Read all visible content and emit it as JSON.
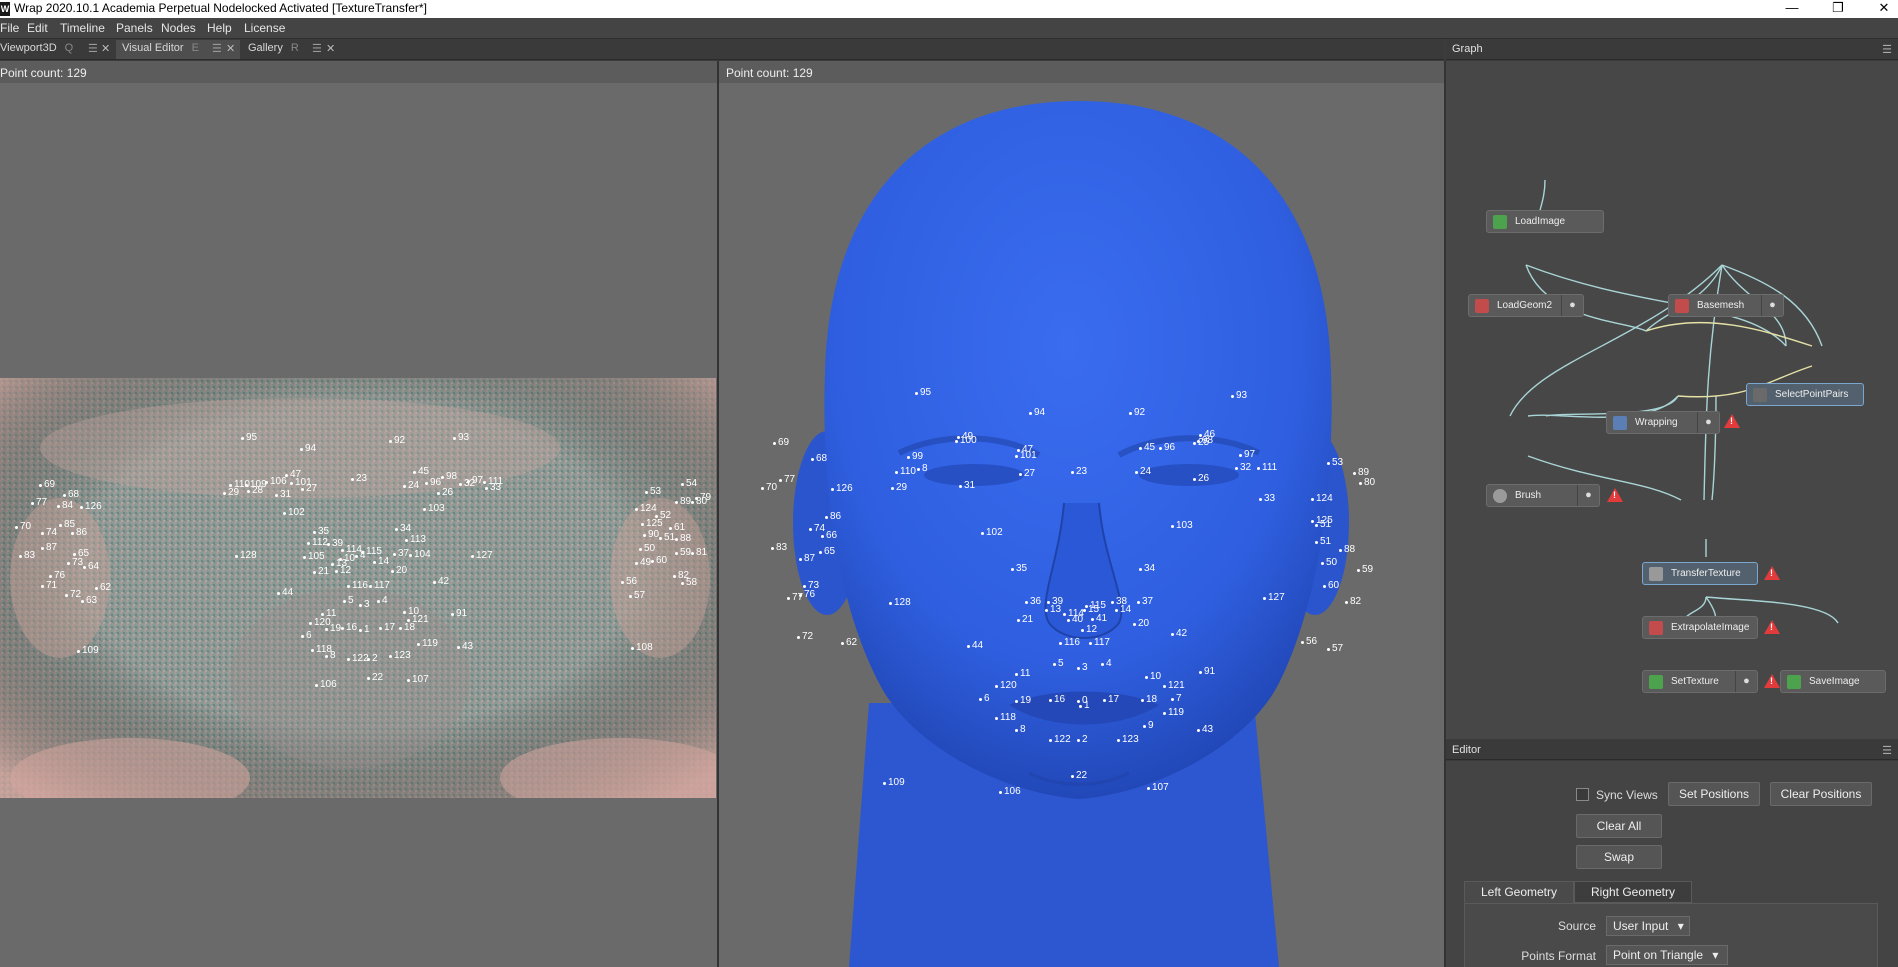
{
  "window": {
    "title": "Wrap 2020.10.1 Academia Perpetual Nodelocked Activated  [TextureTransfer*]",
    "icon_letter": "W",
    "minimize_glyph": "—",
    "restore_glyph": "❐",
    "close_glyph": "✕"
  },
  "menu": [
    "File",
    "Edit",
    "Timeline",
    "Panels",
    "Nodes",
    "Help",
    "License"
  ],
  "tabs": [
    {
      "label": "Viewport3D",
      "hotkey": "Q"
    },
    {
      "label": "Visual Editor",
      "hotkey": "E"
    },
    {
      "label": "Gallery",
      "hotkey": "R"
    }
  ],
  "tab_menu_glyph": "☰",
  "tab_close_glyph": "✕",
  "left_view": {
    "point_count": "Point count: 129"
  },
  "right_view": {
    "point_count": "Point count: 129"
  },
  "graph": {
    "title": "Graph",
    "nodes": {
      "loadimage": "LoadImage",
      "loadgeom2": "LoadGeom2",
      "basemesh": "Basemesh",
      "selectpointpairs": "SelectPointPairs",
      "wrapping": "Wrapping",
      "brush": "Brush",
      "transfertexture": "TransferTexture",
      "extrapolateimage": "ExtrapolateImage",
      "settexture": "SetTexture",
      "saveimage": "SaveImage"
    },
    "warning_glyph": "!"
  },
  "editor": {
    "title": "Editor",
    "sync_views": "Sync Views",
    "set_positions": "Set Positions",
    "clear_positions": "Clear Positions",
    "clear_all": "Clear All",
    "swap": "Swap",
    "tab_left": "Left Geometry",
    "tab_right": "Right Geometry",
    "source_label": "Source",
    "source_value": "User Input",
    "points_format_label": "Points Format",
    "points_format_value": "Point on Triangle",
    "combo_arrow": "▾"
  },
  "colors": {
    "head": "#2f5fe0",
    "head_shadow": "#1f43a8",
    "warning": "#e23b3b",
    "selected_node": "#7aa6d0"
  },
  "landmarks_left": [
    [
      "95",
      246,
      432
    ],
    [
      "94",
      305,
      443
    ],
    [
      "92",
      394,
      435
    ],
    [
      "93",
      458,
      432
    ],
    [
      "69",
      44,
      479
    ],
    [
      "68",
      68,
      489
    ],
    [
      "77",
      36,
      497
    ],
    [
      "84",
      62,
      500
    ],
    [
      "126",
      85,
      501
    ],
    [
      "110",
      234,
      479
    ],
    [
      "109",
      250,
      479
    ],
    [
      "47",
      290,
      469
    ],
    [
      "106",
      270,
      476
    ],
    [
      "101",
      295,
      477
    ],
    [
      "29",
      228,
      487
    ],
    [
      "28",
      252,
      485
    ],
    [
      "31",
      280,
      489
    ],
    [
      "27",
      306,
      483
    ],
    [
      "45",
      418,
      466
    ],
    [
      "96",
      430,
      477
    ],
    [
      "98",
      446,
      471
    ],
    [
      "32",
      464,
      478
    ],
    [
      "97",
      472,
      475
    ],
    [
      "111",
      488,
      476
    ],
    [
      "24",
      408,
      480
    ],
    [
      "26",
      442,
      487
    ],
    [
      "33",
      490,
      482
    ],
    [
      "23",
      356,
      473
    ],
    [
      "102",
      288,
      507
    ],
    [
      "103",
      428,
      503
    ],
    [
      "70",
      20,
      521
    ],
    [
      "74",
      46,
      527
    ],
    [
      "85",
      64,
      519
    ],
    [
      "86",
      76,
      527
    ],
    [
      "83",
      24,
      550
    ],
    [
      "87",
      46,
      542
    ],
    [
      "65",
      78,
      548
    ],
    [
      "73",
      72,
      557
    ],
    [
      "64",
      88,
      561
    ],
    [
      "128",
      240,
      550
    ],
    [
      "35",
      318,
      526
    ],
    [
      "34",
      400,
      523
    ],
    [
      "113",
      410,
      534
    ],
    [
      "127",
      476,
      550
    ],
    [
      "112",
      312,
      537
    ],
    [
      "39",
      332,
      538
    ],
    [
      "114",
      346,
      544
    ],
    [
      "115",
      366,
      546
    ],
    [
      "105",
      308,
      551
    ],
    [
      "10",
      344,
      553
    ],
    [
      "4",
      360,
      550
    ],
    [
      "12",
      340,
      565
    ],
    [
      "13",
      336,
      558
    ],
    [
      "14",
      378,
      556
    ],
    [
      "37",
      398,
      548
    ],
    [
      "104",
      414,
      549
    ],
    [
      "21",
      318,
      566
    ],
    [
      "20",
      396,
      565
    ],
    [
      "42",
      438,
      576
    ],
    [
      "71",
      46,
      580
    ],
    [
      "76",
      54,
      570
    ],
    [
      "72",
      70,
      589
    ],
    [
      "62",
      100,
      582
    ],
    [
      "63",
      86,
      595
    ],
    [
      "116",
      352,
      580
    ],
    [
      "117",
      374,
      580
    ],
    [
      "44",
      282,
      587
    ],
    [
      "5",
      348,
      595
    ],
    [
      "3",
      364,
      599
    ],
    [
      "4",
      382,
      595
    ],
    [
      "11",
      326,
      608
    ],
    [
      "10",
      408,
      606
    ],
    [
      "91",
      456,
      608
    ],
    [
      "120",
      314,
      617
    ],
    [
      "121",
      412,
      614
    ],
    [
      "6",
      306,
      630
    ],
    [
      "19",
      330,
      623
    ],
    [
      "16",
      346,
      622
    ],
    [
      "1",
      364,
      624
    ],
    [
      "17",
      384,
      622
    ],
    [
      "18",
      404,
      622
    ],
    [
      "118",
      316,
      644
    ],
    [
      "119",
      422,
      638
    ],
    [
      "43",
      462,
      641
    ],
    [
      "8",
      330,
      650
    ],
    [
      "122",
      352,
      653
    ],
    [
      "2",
      372,
      653
    ],
    [
      "123",
      394,
      650
    ],
    [
      "22",
      372,
      672
    ],
    [
      "107",
      412,
      674
    ],
    [
      "106",
      320,
      679
    ],
    [
      "109",
      82,
      645
    ],
    [
      "53",
      650,
      486
    ],
    [
      "54",
      686,
      478
    ],
    [
      "124",
      640,
      503
    ],
    [
      "89",
      680,
      496
    ],
    [
      "80",
      696,
      496
    ],
    [
      "79",
      706,
      492
    ],
    [
      "52",
      660,
      510
    ],
    [
      "125",
      646,
      518
    ],
    [
      "61",
      674,
      522
    ],
    [
      "90",
      648,
      529
    ],
    [
      "51",
      664,
      532
    ],
    [
      "88",
      680,
      533
    ],
    [
      "50",
      644,
      543
    ],
    [
      "59",
      680,
      547
    ],
    [
      "81",
      696,
      547
    ],
    [
      "49",
      640,
      557
    ],
    [
      "60",
      656,
      555
    ],
    [
      "56",
      626,
      576
    ],
    [
      "57",
      634,
      590
    ],
    [
      "82",
      678,
      570
    ],
    [
      "58",
      686,
      577
    ],
    [
      "108",
      636,
      642
    ]
  ],
  "landmarks_right": [
    [
      "95",
      920,
      387
    ],
    [
      "94",
      1034,
      407
    ],
    [
      "92",
      1134,
      407
    ],
    [
      "93",
      1236,
      390
    ],
    [
      "69",
      778,
      437
    ],
    [
      "68",
      816,
      453
    ],
    [
      "70",
      766,
      482
    ],
    [
      "77",
      784,
      474
    ],
    [
      "126",
      836,
      483
    ],
    [
      "49",
      962,
      431
    ],
    [
      "100",
      960,
      435
    ],
    [
      "47",
      1022,
      444
    ],
    [
      "101",
      1020,
      450
    ],
    [
      "99",
      912,
      451
    ],
    [
      "110",
      900,
      466
    ],
    [
      "8",
      922,
      463
    ],
    [
      "29",
      896,
      482
    ],
    [
      "31",
      964,
      480
    ],
    [
      "27",
      1024,
      468
    ],
    [
      "23",
      1076,
      466
    ],
    [
      "45",
      1144,
      442
    ],
    [
      "96",
      1164,
      442
    ],
    [
      "46",
      1204,
      429
    ],
    [
      "25",
      1198,
      437
    ],
    [
      "98",
      1202,
      435
    ],
    [
      "97",
      1244,
      449
    ],
    [
      "32",
      1240,
      462
    ],
    [
      "111",
      1262,
      462
    ],
    [
      "24",
      1140,
      466
    ],
    [
      "26",
      1198,
      473
    ],
    [
      "33",
      1264,
      493
    ],
    [
      "53",
      1332,
      457
    ],
    [
      "89",
      1358,
      467
    ],
    [
      "80",
      1364,
      477
    ],
    [
      "124",
      1316,
      493
    ],
    [
      "86",
      830,
      511
    ],
    [
      "74",
      814,
      523
    ],
    [
      "66",
      826,
      530
    ],
    [
      "83",
      776,
      542
    ],
    [
      "87",
      804,
      553
    ],
    [
      "65",
      824,
      546
    ],
    [
      "102",
      986,
      527
    ],
    [
      "103",
      1176,
      520
    ],
    [
      "125",
      1316,
      515
    ],
    [
      "51",
      1320,
      519
    ],
    [
      "51",
      1320,
      536
    ],
    [
      "88",
      1344,
      544
    ],
    [
      "73",
      808,
      580
    ],
    [
      "77",
      792,
      592
    ],
    [
      "76",
      804,
      589
    ],
    [
      "72",
      802,
      631
    ],
    [
      "62",
      846,
      637
    ],
    [
      "128",
      894,
      597
    ],
    [
      "35",
      1016,
      563
    ],
    [
      "34",
      1144,
      563
    ],
    [
      "50",
      1326,
      557
    ],
    [
      "59",
      1362,
      564
    ],
    [
      "60",
      1328,
      580
    ],
    [
      "82",
      1350,
      596
    ],
    [
      "127",
      1268,
      592
    ],
    [
      "36",
      1030,
      596
    ],
    [
      "39",
      1052,
      596
    ],
    [
      "13",
      1050,
      604
    ],
    [
      "114",
      1068,
      608
    ],
    [
      "115",
      1090,
      600
    ],
    [
      "15",
      1088,
      604
    ],
    [
      "40",
      1072,
      614
    ],
    [
      "41",
      1096,
      613
    ],
    [
      "38",
      1116,
      596
    ],
    [
      "14",
      1120,
      604
    ],
    [
      "37",
      1142,
      596
    ],
    [
      "21",
      1022,
      614
    ],
    [
      "12",
      1086,
      624
    ],
    [
      "20",
      1138,
      618
    ],
    [
      "42",
      1176,
      628
    ],
    [
      "44",
      972,
      640
    ],
    [
      "116",
      1064,
      637
    ],
    [
      "117",
      1094,
      637
    ],
    [
      "56",
      1306,
      636
    ],
    [
      "57",
      1332,
      643
    ],
    [
      "5",
      1058,
      658
    ],
    [
      "3",
      1082,
      662
    ],
    [
      "4",
      1106,
      658
    ],
    [
      "11",
      1020,
      668
    ],
    [
      "10",
      1150,
      671
    ],
    [
      "91",
      1204,
      666
    ],
    [
      "120",
      1000,
      680
    ],
    [
      "121",
      1168,
      680
    ],
    [
      "6",
      984,
      693
    ],
    [
      "19",
      1020,
      695
    ],
    [
      "16",
      1054,
      694
    ],
    [
      "0",
      1082,
      695
    ],
    [
      "1",
      1084,
      700
    ],
    [
      "17",
      1108,
      694
    ],
    [
      "18",
      1146,
      694
    ],
    [
      "7",
      1176,
      693
    ],
    [
      "119",
      1168,
      707
    ],
    [
      "118",
      1000,
      712
    ],
    [
      "8",
      1020,
      724
    ],
    [
      "9",
      1148,
      720
    ],
    [
      "43",
      1202,
      724
    ],
    [
      "122",
      1054,
      734
    ],
    [
      "2",
      1082,
      734
    ],
    [
      "123",
      1122,
      734
    ],
    [
      "22",
      1076,
      770
    ],
    [
      "109",
      888,
      777
    ],
    [
      "106",
      1004,
      786
    ],
    [
      "107",
      1152,
      782
    ]
  ]
}
